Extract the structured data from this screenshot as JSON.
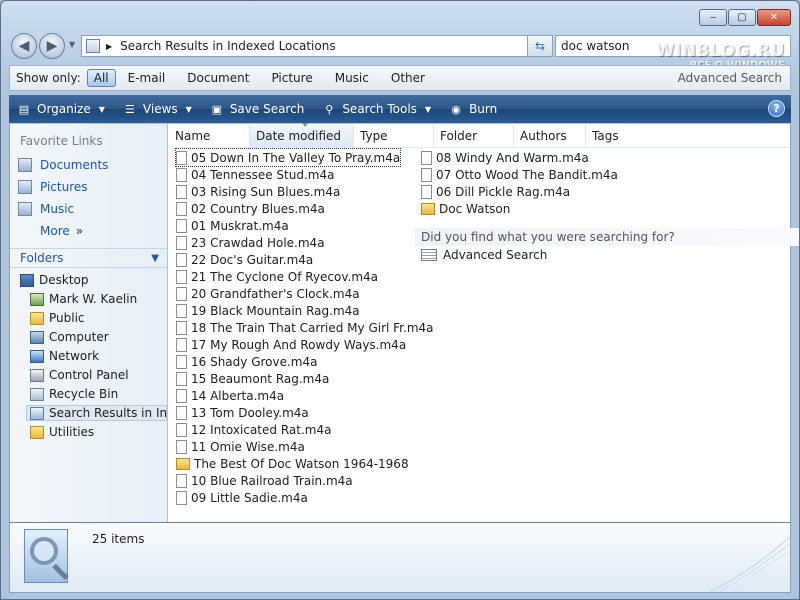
{
  "window": {
    "caption": {
      "minimize": "‒",
      "maximize": "▢",
      "close": "✕"
    }
  },
  "address": {
    "path": "Search Results in Indexed Locations",
    "search_value": "doc watson"
  },
  "watermark": {
    "line1": "WINBLOG.RU",
    "line2": "ВСЁ О WINDOWS"
  },
  "show_only": {
    "label": "Show only:",
    "filters": [
      "All",
      "E-mail",
      "Document",
      "Picture",
      "Music",
      "Other"
    ],
    "advanced_search": "Advanced Search"
  },
  "toolbar": {
    "organize": "Organize",
    "views": "Views",
    "save_search": "Save Search",
    "search_tools": "Search Tools",
    "burn": "Burn",
    "help": "?"
  },
  "nav": {
    "favorite_links_label": "Favorite Links",
    "favorites": [
      "Documents",
      "Pictures",
      "Music"
    ],
    "more": "More",
    "folders_label": "Folders",
    "tree": [
      "Desktop",
      "Mark W. Kaelin",
      "Public",
      "Computer",
      "Network",
      "Control Panel",
      "Recycle Bin",
      "Search Results in Inde",
      "Utilities"
    ]
  },
  "columns": [
    "Name",
    "Date modified",
    "Type",
    "Folder",
    "Authors",
    "Tags"
  ],
  "files_col1": [
    "05 Down In The Valley To Pray.m4a",
    "04 Tennessee Stud.m4a",
    "03 Rising Sun Blues.m4a",
    "02 Country Blues.m4a",
    "01 Muskrat.m4a",
    "23 Crawdad Hole.m4a",
    "22 Doc's Guitar.m4a",
    "21 The Cyclone Of Ryecov.m4a",
    "20 Grandfather's Clock.m4a",
    "19 Black Mountain Rag.m4a",
    "18 The Train That Carried My Girl Fr.m4a",
    "17 My Rough And Rowdy Ways.m4a",
    "16 Shady Grove.m4a",
    "15 Beaumont Rag.m4a",
    "14 Alberta.m4a",
    "13 Tom Dooley.m4a",
    "12 Intoxicated Rat.m4a",
    "11 Omie Wise.m4a",
    "The Best Of Doc Watson 1964-1968",
    "10 Blue Railroad Train.m4a",
    "09 Little Sadie.m4a"
  ],
  "files_col2": [
    "08 Windy And Warm.m4a",
    "07 Otto Wood The Bandit.m4a",
    "06 Dill Pickle Rag.m4a",
    "Doc Watson"
  ],
  "search_prompt": {
    "question": "Did you find what you were searching for?",
    "advanced_search": "Advanced Search"
  },
  "details": {
    "item_count": "25 items"
  }
}
